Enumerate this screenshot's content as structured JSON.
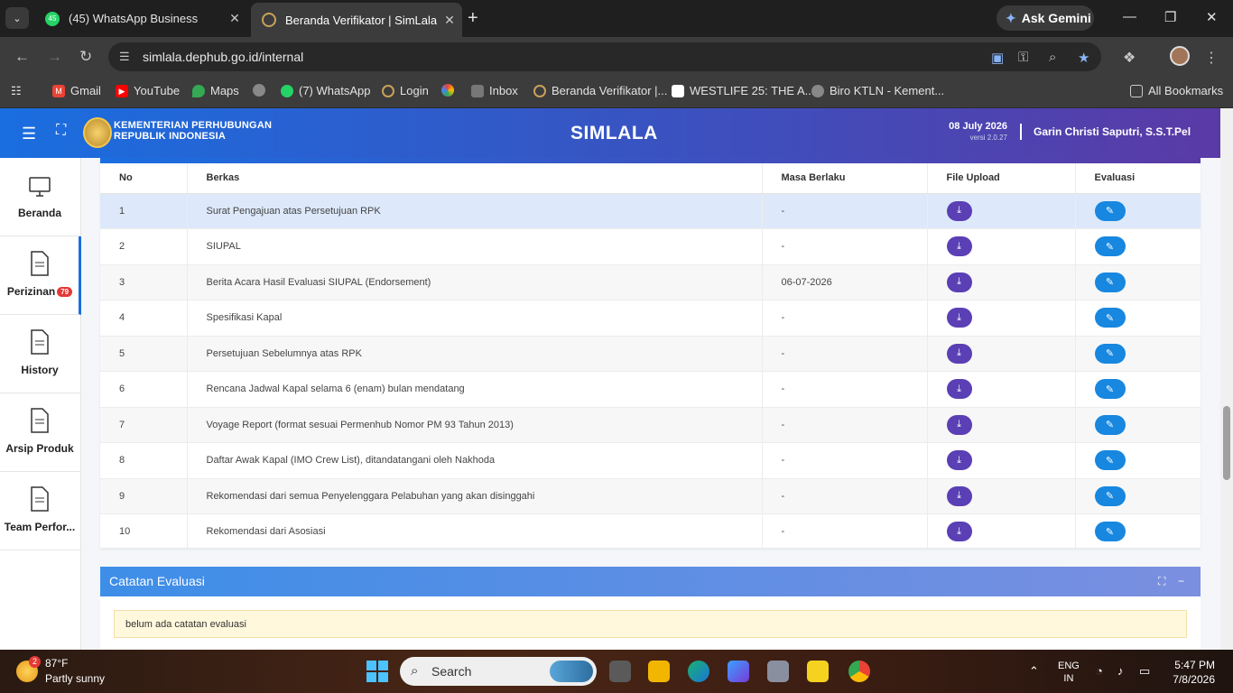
{
  "browser": {
    "tabs": [
      {
        "label": "(45) WhatsApp Business",
        "badge": "45"
      },
      {
        "label": "Beranda Verifikator | SimLala"
      }
    ],
    "ask_gemini": "Ask Gemini",
    "url": "simlala.dephub.go.id/internal",
    "bookmarks": [
      "Gmail",
      "YouTube",
      "Maps",
      "(7) WhatsApp",
      "Login",
      "Inbox",
      "Beranda Verifikator |...",
      "WESTLIFE 25: THE A...",
      "Biro KTLN - Kement..."
    ],
    "all_bookmarks": "All Bookmarks"
  },
  "header": {
    "ministry_line1": "KEMENTERIAN PERHUBUNGAN",
    "ministry_line2": "REPUBLIK INDONESIA",
    "title": "SIMLALA",
    "date": "08 July 2026",
    "version": "versi 2.0.27",
    "user": "Garin Christi Saputri, S.S.T.Pel"
  },
  "sidebar": {
    "items": [
      {
        "label": "Beranda"
      },
      {
        "label": "Perizinan",
        "badge": "79"
      },
      {
        "label": "History"
      },
      {
        "label": "Arsip Produk"
      },
      {
        "label": "Team Perfor..."
      }
    ]
  },
  "table": {
    "headers": [
      "No",
      "Berkas",
      "Masa Berlaku",
      "File Upload",
      "Evaluasi"
    ],
    "rows": [
      {
        "no": "1",
        "berkas": "Surat Pengajuan atas Persetujuan RPK",
        "masa": "-"
      },
      {
        "no": "2",
        "berkas": "SIUPAL",
        "masa": "-"
      },
      {
        "no": "3",
        "berkas": "Berita Acara Hasil Evaluasi SIUPAL (Endorsement)",
        "masa": "06-07-2026"
      },
      {
        "no": "4",
        "berkas": "Spesifikasi Kapal",
        "masa": "-"
      },
      {
        "no": "5",
        "berkas": "Persetujuan Sebelumnya atas RPK",
        "masa": "-"
      },
      {
        "no": "6",
        "berkas": "Rencana Jadwal Kapal selama 6 (enam) bulan mendatang",
        "masa": "-"
      },
      {
        "no": "7",
        "berkas": "Voyage Report (format sesuai Permenhub Nomor PM 93 Tahun 2013)",
        "masa": "-"
      },
      {
        "no": "8",
        "berkas": "Daftar Awak Kapal (IMO Crew List), ditandatangani oleh Nakhoda",
        "masa": "-"
      },
      {
        "no": "9",
        "berkas": "Rekomendasi dari semua Penyelenggara Pelabuhan yang akan disinggahi",
        "masa": "-"
      },
      {
        "no": "10",
        "berkas": "Rekomendasi dari Asosiasi",
        "masa": "-"
      }
    ]
  },
  "evaluation": {
    "title": "Catatan Evaluasi",
    "note": "belum ada catatan evaluasi"
  },
  "taskbar": {
    "weather_badge": "2",
    "temp": "87°F",
    "weather": "Partly sunny",
    "search": "Search",
    "lang1": "ENG",
    "lang2": "IN",
    "time": "5:47 PM",
    "date": "7/8/2026"
  }
}
